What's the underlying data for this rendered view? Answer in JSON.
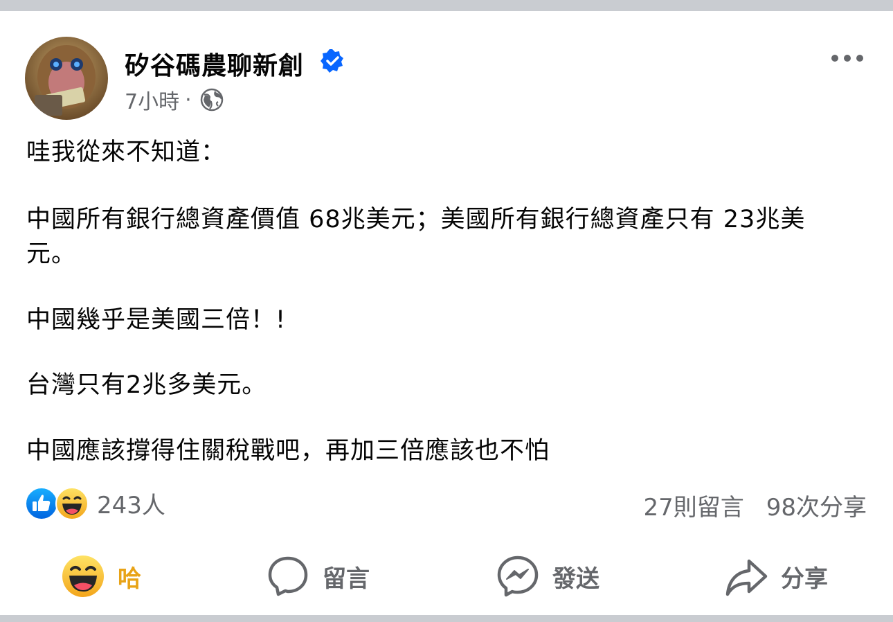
{
  "post": {
    "page_name": "矽谷碼農聊新創",
    "timestamp": "7小時",
    "separator": "·",
    "body_lines": [
      "哇我從來不知道：",
      "中國所有銀行總資產價值 68兆美元；美國所有銀行總資產只有 23兆美",
      "元。",
      "中國幾乎是美國三倍！!",
      "台灣只有2兆多美元。",
      "中國應該撐得住關稅戰吧，再加三倍應該也不怕"
    ]
  },
  "engagement": {
    "reaction_count": "243人",
    "comments": "27則留言",
    "shares": "98次分享"
  },
  "actions": {
    "haha_label": "哈",
    "comment_label": "留言",
    "send_label": "發送",
    "share_label": "分享"
  },
  "colors": {
    "verified_blue": "#0866ff",
    "haha_yellow": "#f7b928",
    "secondary_text": "#65676b"
  },
  "icons": [
    "verified-badge-icon",
    "globe-icon",
    "more-options-icon",
    "like-reaction-icon",
    "haha-reaction-icon",
    "comment-bubble-icon",
    "messenger-icon",
    "share-arrow-icon"
  ]
}
